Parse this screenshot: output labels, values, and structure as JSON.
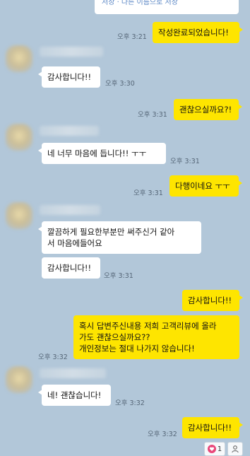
{
  "messages": {
    "top_card_text": "저장 · 다른 이름으로 저장",
    "m1": {
      "text": "작성완료되었습니다!",
      "time": "오후 3:21"
    },
    "m2": {
      "text": "감사합니다!!",
      "time": "오후 3:30"
    },
    "m3": {
      "text": "괜찮으실까요?!",
      "time": "오후 3:31"
    },
    "m4": {
      "text": "네 너무 마음에 듭니다!! ㅜㅜ",
      "time": "오후 3:31"
    },
    "m5": {
      "text": "다행이네요 ㅜㅜ",
      "time": "오후 3:31"
    },
    "m6": {
      "text": "깔끔하게 필요한부분만 써주신거 같아\n서 마음에들어요"
    },
    "m7": {
      "text": "감사합니다!!",
      "time": "오후 3:31"
    },
    "m8": {
      "text": "감사합니다!!"
    },
    "m9": {
      "text": "혹시 답변주신내용 저희 고객리뷰에 올라\n가도 괜찮으실까요??\n개인정보는 절대 나가지 않습니다!",
      "time": "오후 3:32"
    },
    "m10": {
      "text": "네! 괜찮습니다!",
      "time": "오후 3:32"
    },
    "m11": {
      "text": "감사합니다!!",
      "time": "오후 3:32"
    }
  },
  "footer": {
    "like_count": "1"
  },
  "colors": {
    "background": "#b2c7d9",
    "my_bubble": "#fee500",
    "other_bubble": "#ffffff",
    "heart": "#e8477a"
  },
  "icons": [
    "heart-icon",
    "person-icon"
  ]
}
